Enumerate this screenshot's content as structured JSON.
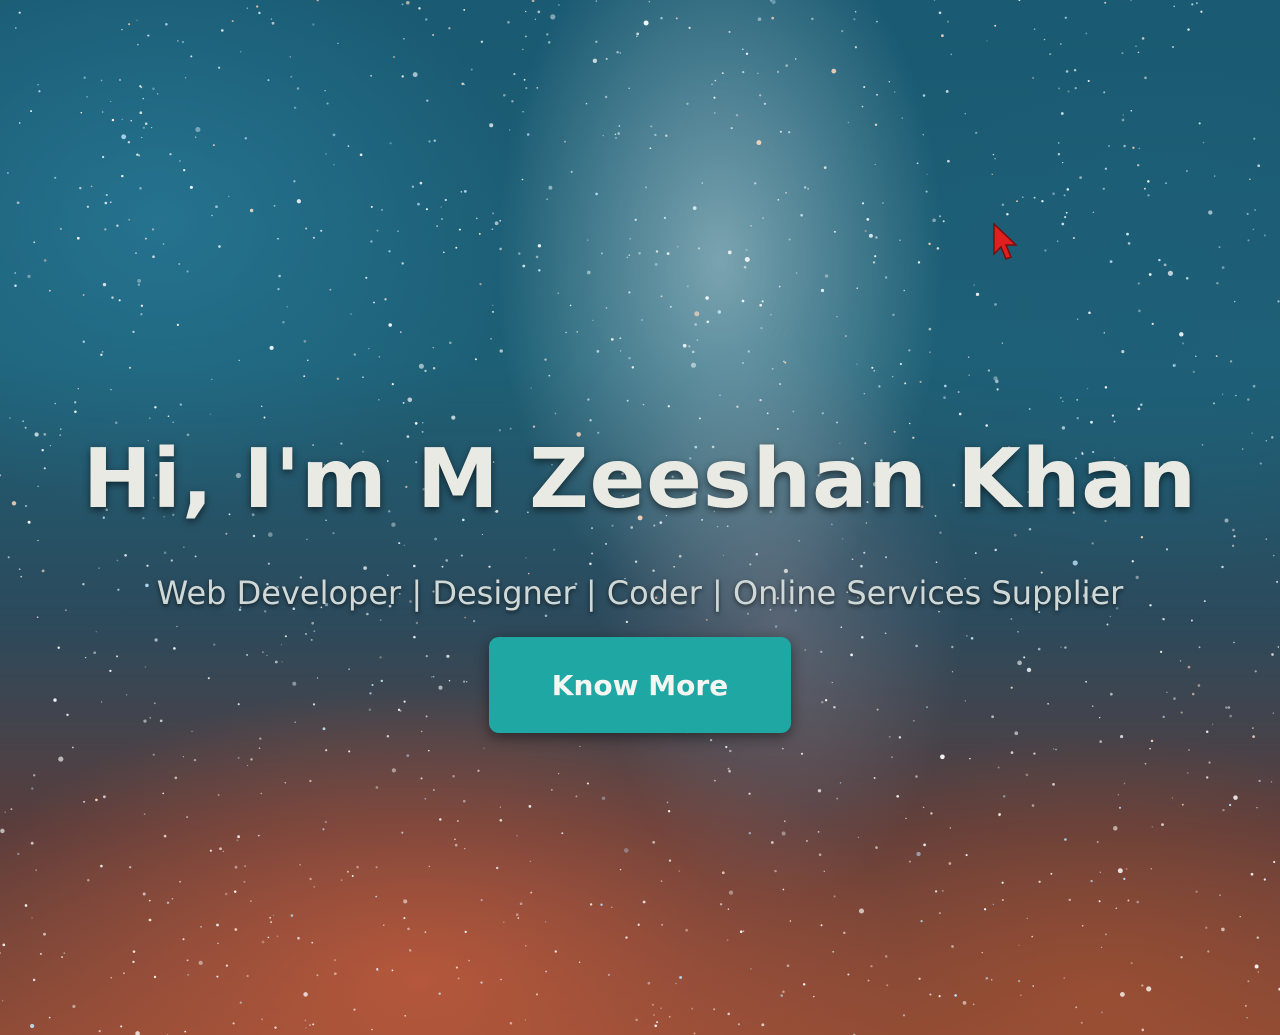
{
  "hero": {
    "title": "Hi, I'm M Zeeshan Khan",
    "subtitle": "Web Developer | Designer | Coder | Online Services Supplier",
    "cta_label": "Know More"
  },
  "icons": {
    "cursor": "mouse-pointer-icon"
  },
  "colors": {
    "cta_background": "#1fa7a3",
    "title_text": "#e9eae4",
    "cursor": "#e02020"
  }
}
